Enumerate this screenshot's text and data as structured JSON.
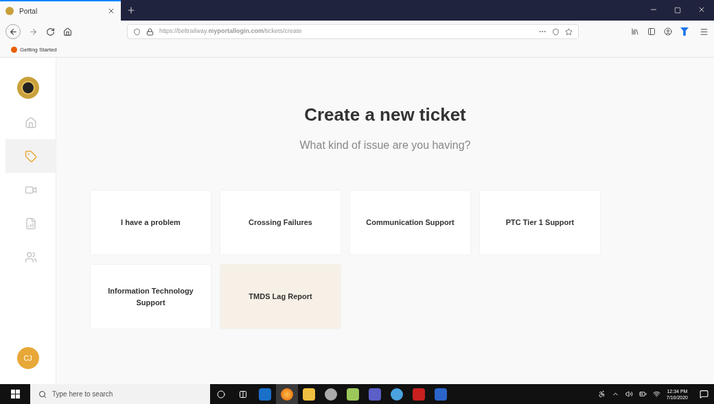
{
  "browser": {
    "tab_title": "Portal",
    "url": "https://beltrailway.**myportallogin.com**/tickets/create",
    "bookmark": "Getting Started"
  },
  "sidebar": {
    "items": [
      {
        "kind": "home",
        "selected": false
      },
      {
        "kind": "tag",
        "selected": true
      },
      {
        "kind": "video",
        "selected": false
      },
      {
        "kind": "chart",
        "selected": false
      },
      {
        "kind": "people",
        "selected": false
      }
    ],
    "avatar": "CJ"
  },
  "page": {
    "title": "Create a new ticket",
    "subtitle": "What kind of issue are you having?"
  },
  "categories": [
    {
      "label": "I have a problem",
      "selected": false
    },
    {
      "label": "Crossing Failures",
      "selected": false
    },
    {
      "label": "Communication Support",
      "selected": false
    },
    {
      "label": "PTC Tier 1 Support",
      "selected": false
    },
    {
      "label": "Information Technology Support",
      "selected": false
    },
    {
      "label": "TMDS Lag Report",
      "selected": true
    }
  ],
  "taskbar": {
    "search_placeholder": "Type here to search",
    "time": "12:34 PM",
    "date": "7/10/2020"
  }
}
